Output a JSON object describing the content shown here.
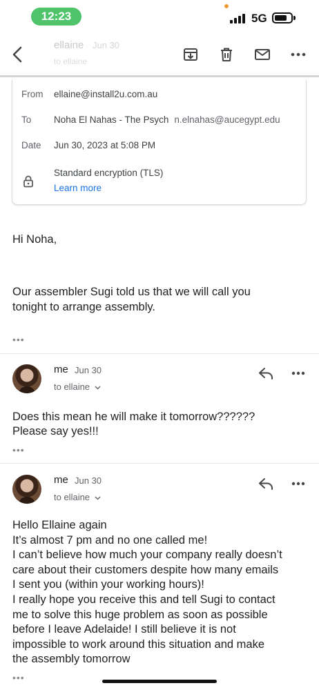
{
  "status_bar": {
    "time": "12:23",
    "network": "5G",
    "battery_level": 0.75
  },
  "toolbar": {
    "ghost_sender": "ellaine",
    "ghost_date": "Jun 30",
    "ghost_line2": "to ellaine"
  },
  "details": {
    "from_label": "From",
    "from_value": "ellaine@install2u.com.au",
    "to_label": "To",
    "to_name": "Noha El Nahas - The Psych",
    "to_email": "n.elnahas@aucegypt.edu",
    "date_label": "Date",
    "date_value": "Jun 30, 2023 at 5:08 PM",
    "encryption": "Standard encryption (TLS)",
    "learn_more": "Learn more"
  },
  "first_message": {
    "greeting": "Hi Noha,",
    "lines": [
      "Our assembler Sugi told us that we will call you",
      "tonight to arrange assembly."
    ],
    "more_dots": "•••"
  },
  "messages": [
    {
      "sender": "me",
      "date": "Jun 30",
      "to_line": "to ellaine",
      "lines": [
        "Does this mean he will make it tomorrow??????",
        "Please say yes!!!"
      ],
      "more_dots": "•••"
    },
    {
      "sender": "me",
      "date": "Jun 30",
      "to_line": "to ellaine",
      "lines": [
        "Hello Ellaine again",
        "It’s almost 7 pm and no one called me!",
        "I can’t believe how much your company really doesn’t",
        "care about their customers despite how many emails",
        "I sent you (within your working hours)!",
        "I really hope you receive this and tell Sugi to contact",
        "me to solve this huge problem as soon as possible",
        "before I leave Adelaide! I still believe it is not",
        "impossible to work around this situation and make",
        "the assembly tomorrow"
      ],
      "more_dots": "•••"
    }
  ]
}
